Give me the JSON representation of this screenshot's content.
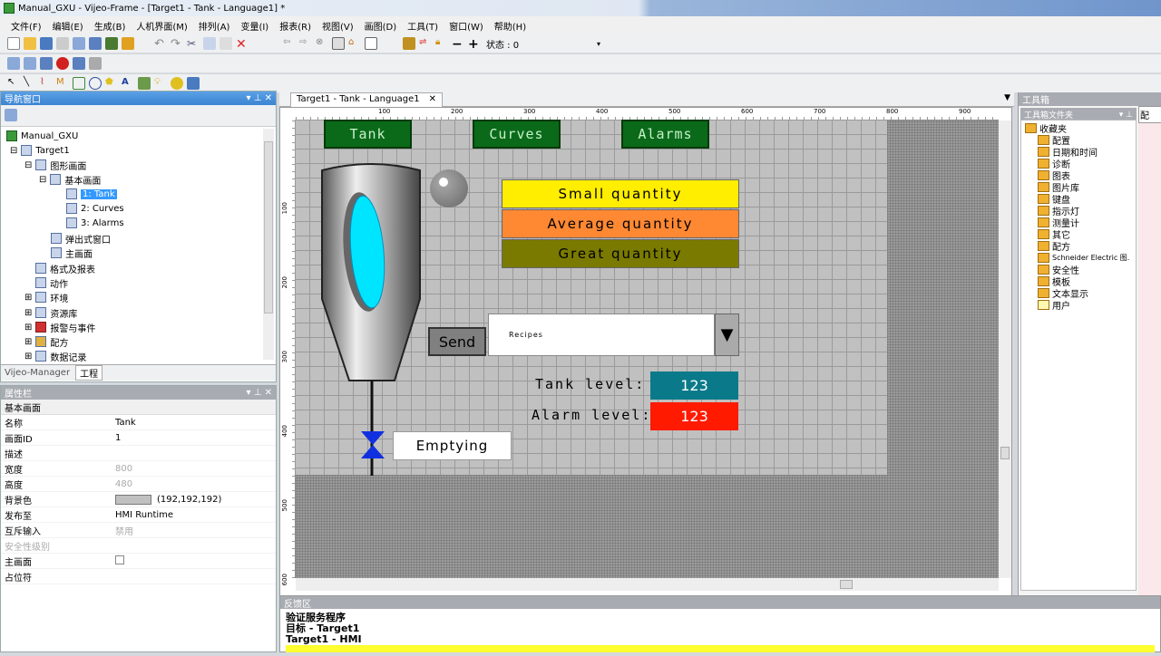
{
  "title": "Manual_GXU - Vijeo-Frame - [Target1 - Tank - Language1] *",
  "menu": [
    "文件(F)",
    "编辑(E)",
    "生成(B)",
    "人机界面(M)",
    "排列(A)",
    "变量(I)",
    "报表(R)",
    "视图(V)",
    "画图(D)",
    "工具(T)",
    "窗口(W)",
    "帮助(H)"
  ],
  "toolbar": {
    "status_label": "状态 : 0"
  },
  "nav": {
    "title": "导航窗口",
    "items": [
      "Manual_GXU",
      "Target1",
      "图形画面",
      "基本画面",
      "1: Tank",
      "2: Curves",
      "3: Alarms",
      "弹出式窗口",
      "主画面",
      "格式及报表",
      "动作",
      "环境",
      "资源库",
      "报警与事件",
      "配方",
      "数据记录"
    ],
    "tabs": [
      "Vijeo-Manager",
      "工程"
    ]
  },
  "props": {
    "title": "属性栏",
    "section": "基本画面",
    "rows": [
      {
        "k": "名称",
        "v": "Tank"
      },
      {
        "k": "画面ID",
        "v": "1"
      },
      {
        "k": "描述",
        "v": ""
      },
      {
        "k": "宽度",
        "v": "800"
      },
      {
        "k": "高度",
        "v": "480"
      },
      {
        "k": "背景色",
        "v": "(192,192,192)"
      },
      {
        "k": "发布至",
        "v": "HMI Runtime"
      },
      {
        "k": "互斥输入",
        "v": "禁用"
      },
      {
        "k": "安全性级别",
        "v": ""
      },
      {
        "k": "主画面",
        "v": ""
      },
      {
        "k": "占位符",
        "v": ""
      }
    ]
  },
  "editor": {
    "tab": "Target1 - Tank - Language1",
    "ruler_x": [
      "100",
      "200",
      "300",
      "400",
      "500",
      "600",
      "700",
      "800",
      "900"
    ],
    "ruler_y": [
      "100",
      "200",
      "300",
      "400",
      "500",
      "600"
    ]
  },
  "screen": {
    "nav_buttons": [
      "Tank",
      "Curves",
      "Alarms"
    ],
    "quantities": [
      {
        "label": "Small quantity",
        "color": "#ffee00"
      },
      {
        "label": "Average quantity",
        "color": "#ff8833"
      },
      {
        "label": "Great quantity",
        "color": "#7a7a00"
      }
    ],
    "send": "Send",
    "recipes": "Recipes",
    "tank_level_label": "Tank level:",
    "tank_level": "123",
    "alarm_level_label": "Alarm level:",
    "alarm_level": "123",
    "emptying": "Emptying"
  },
  "toolbox": {
    "title": "工具箱",
    "folder_title": "工具箱文件夹",
    "items": [
      "收藏夹",
      "配置",
      "日期和时间",
      "诊断",
      "图表",
      "图片库",
      "键盘",
      "指示灯",
      "测量计",
      "其它",
      "配方",
      "Schneider Electric 图.",
      "安全性",
      "模板",
      "文本显示",
      "用户"
    ],
    "side_tab": "配"
  },
  "feedback": {
    "title": "反馈区",
    "lines": [
      "验证服务程序",
      "目标 - Target1",
      "Target1 - HMI"
    ]
  }
}
